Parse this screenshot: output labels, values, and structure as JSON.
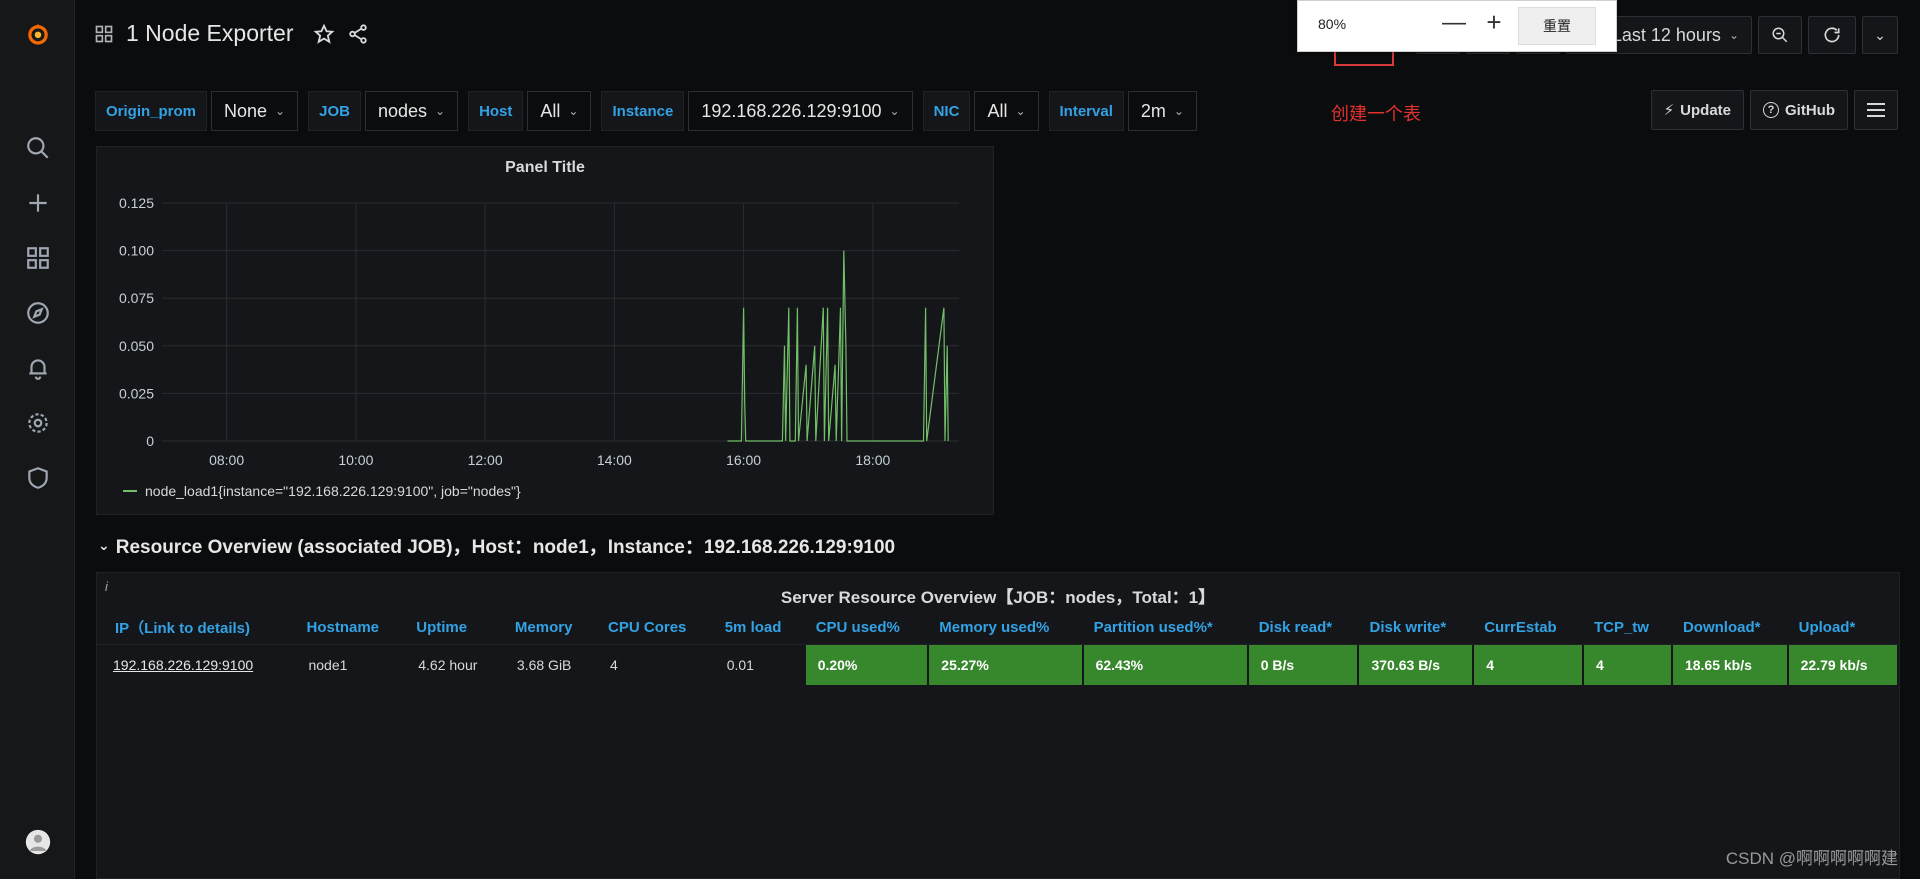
{
  "dashboard": {
    "title": "1 Node Exporter"
  },
  "time_picker": {
    "label": "Last 12 hours"
  },
  "zoom_popup": {
    "percent": "80%",
    "reset_label": "重置"
  },
  "annotation": {
    "text": "创建一个表"
  },
  "variables": [
    {
      "label": "Origin_prom",
      "value": "None"
    },
    {
      "label": "JOB",
      "value": "nodes"
    },
    {
      "label": "Host",
      "value": "All"
    },
    {
      "label": "Instance",
      "value": "192.168.226.129:9100"
    },
    {
      "label": "NIC",
      "value": "All"
    },
    {
      "label": "Interval",
      "value": "2m"
    }
  ],
  "actions": {
    "update": "Update",
    "github": "GitHub"
  },
  "panel": {
    "title": "Panel Title",
    "legend": "node_load1{instance=\"192.168.226.129:9100\", job=\"nodes\"}"
  },
  "chart_data": {
    "type": "line",
    "title": "Panel Title",
    "x_ticks": [
      "08:00",
      "10:00",
      "12:00",
      "14:00",
      "16:00",
      "18:00"
    ],
    "y_ticks": [
      "0",
      "0.025",
      "0.050",
      "0.075",
      "0.100",
      "0.125"
    ],
    "ylim": [
      0,
      0.125
    ],
    "xlim": [
      "07:00",
      "19:20"
    ],
    "grid": true,
    "legend_position": "bottom-left",
    "series": [
      {
        "name": "node_load1{instance=\"192.168.226.129:9100\", job=\"nodes\"}",
        "color": "#73bf69",
        "points": [
          [
            "15:45",
            0
          ],
          [
            "15:58",
            0
          ],
          [
            "16:00",
            0.07
          ],
          [
            "16:01",
            0.02
          ],
          [
            "16:02",
            0
          ],
          [
            "16:36",
            0
          ],
          [
            "16:38",
            0.05
          ],
          [
            "16:39",
            0
          ],
          [
            "16:42",
            0.07
          ],
          [
            "16:43",
            0
          ],
          [
            "16:48",
            0.0
          ],
          [
            "16:50",
            0.07
          ],
          [
            "16:51",
            0
          ],
          [
            "16:58",
            0.04
          ],
          [
            "16:59",
            0
          ],
          [
            "17:06",
            0.05
          ],
          [
            "17:07",
            0
          ],
          [
            "17:14",
            0.07
          ],
          [
            "17:15",
            0
          ],
          [
            "17:18",
            0.07
          ],
          [
            "17:19",
            0
          ],
          [
            "17:25",
            0.04
          ],
          [
            "17:26",
            0
          ],
          [
            "17:30",
            0.07
          ],
          [
            "17:31",
            0
          ],
          [
            "17:33",
            0.1
          ],
          [
            "17:35",
            0.05
          ],
          [
            "17:36",
            0
          ],
          [
            "18:47",
            0
          ],
          [
            "18:49",
            0.07
          ],
          [
            "18:50",
            0
          ],
          [
            "19:06",
            0.07
          ],
          [
            "19:07",
            0
          ],
          [
            "19:09",
            0.05
          ],
          [
            "19:10",
            0
          ]
        ]
      }
    ]
  },
  "row": {
    "title": "Resource Overview (associated JOB)，Host：node1，Instance：192.168.226.129:9100"
  },
  "table_panel": {
    "title": "Server Resource Overview【JOB：nodes，Total：1】",
    "columns": [
      "IP（Link to details)",
      "Hostname",
      "Uptime",
      "Memory",
      "CPU Cores",
      "5m load",
      "CPU used%",
      "Memory used%",
      "Partition used%*",
      "Disk read*",
      "Disk write*",
      "CurrEstab",
      "TCP_tw",
      "Download*",
      "Upload*"
    ],
    "rows": [
      [
        "192.168.226.129:9100",
        "node1",
        "4.62 hour",
        "3.68 GiB",
        "4",
        "0.01",
        "0.20%",
        "25.27%",
        "62.43%",
        "0 B/s",
        "370.63 B/s",
        "4",
        "4",
        "18.65 kb/s",
        "22.79 kb/s"
      ]
    ]
  },
  "watermark": {
    "text": "CSDN @啊啊啊啊啊建"
  },
  "colors": {
    "accent": "#33a2e5",
    "series": "#73bf69",
    "cell_ok": "#37872d",
    "annotation": "#e0322f"
  }
}
